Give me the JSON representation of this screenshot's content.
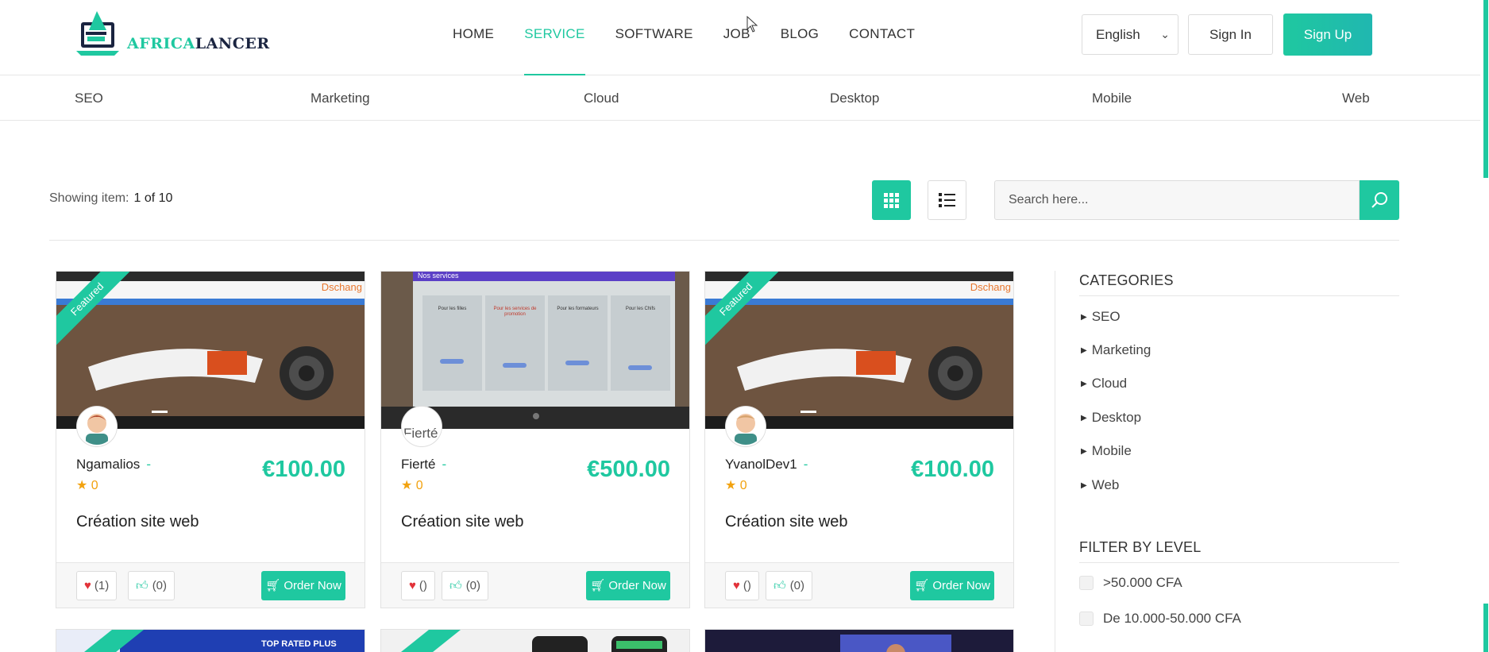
{
  "brand": {
    "name_a": "AFRICA",
    "name_b": "LANCER",
    "accent": "#1fc8a0",
    "dark": "#1a2440"
  },
  "nav": [
    {
      "label": "HOME",
      "active": false
    },
    {
      "label": "SERVICE",
      "active": true
    },
    {
      "label": "SOFTWARE",
      "active": false
    },
    {
      "label": "JOB",
      "active": false
    },
    {
      "label": "BLOG",
      "active": false
    },
    {
      "label": "CONTACT",
      "active": false
    }
  ],
  "header": {
    "language": "English",
    "signin": "Sign In",
    "signup": "Sign Up"
  },
  "categories_bar": [
    "SEO",
    "Marketing",
    "Cloud",
    "Desktop",
    "Mobile",
    "Web"
  ],
  "toolbar": {
    "showing_label": "Showing item:",
    "showing_value": "1 of 10",
    "search_placeholder": "Search here..."
  },
  "cards": [
    {
      "featured": true,
      "ribbon": "Featured",
      "seller": "Ngamalios",
      "dash": "-",
      "rating": "0",
      "price": "€100.00",
      "title": "Création site web",
      "favorites": "(1)",
      "likes": "(0)",
      "order": "Order Now",
      "watermark": "Dschang"
    },
    {
      "featured": false,
      "ribbon": "",
      "seller": "Fierté",
      "dash": "-",
      "rating": "0",
      "price": "€500.00",
      "title": "Création site web",
      "favorites": "()",
      "likes": "(0)",
      "order": "Order Now",
      "avatar_alt": "Fierté",
      "screen_heading": "Nos services",
      "screen_cols": [
        "Pour les filles",
        "Pour les services de promotion",
        "Pour les formateurs",
        "Pour les Chifs"
      ]
    },
    {
      "featured": true,
      "ribbon": "Featured",
      "seller": "YvanolDev1",
      "dash": "-",
      "rating": "0",
      "price": "€100.00",
      "title": "Création site web",
      "favorites": "()",
      "likes": "(0)",
      "order": "Order Now",
      "watermark": "Dschang"
    }
  ],
  "second_row": {
    "badge_text": "TOP RATED PLUS",
    "ribbon": "Featured"
  },
  "sidebar": {
    "categories_title": "CATEGORIES",
    "categories": [
      "SEO",
      "Marketing",
      "Cloud",
      "Desktop",
      "Mobile",
      "Web"
    ],
    "filter_title": "FILTER BY LEVEL",
    "filters": [
      ">50.000 CFA",
      "De 10.000-50.000 CFA"
    ]
  },
  "icons": {
    "search": "search-icon",
    "grid": "grid-view-icon",
    "list": "list-view-icon",
    "heart": "heart-icon",
    "thumb": "thumbs-up-icon",
    "cart": "cart-icon",
    "star": "star-icon"
  }
}
